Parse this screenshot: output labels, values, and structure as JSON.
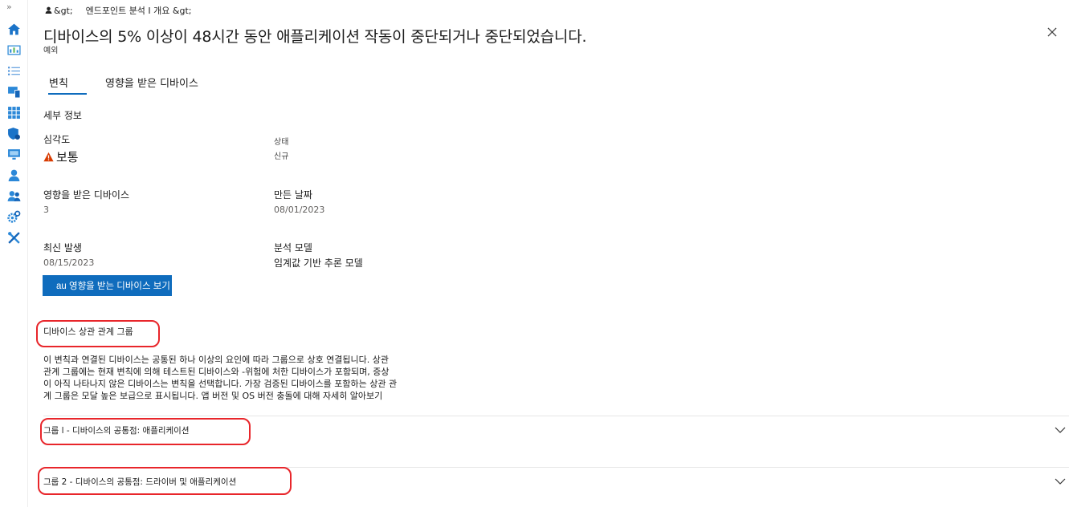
{
  "nav": {
    "expand_label": "»",
    "items": [
      {
        "icon": "home-icon"
      },
      {
        "icon": "dashboard-icon"
      },
      {
        "icon": "list-icon"
      },
      {
        "icon": "devices-icon"
      },
      {
        "icon": "apps-grid-icon"
      },
      {
        "icon": "security-icon"
      },
      {
        "icon": "monitor-icon"
      },
      {
        "icon": "user-icon"
      },
      {
        "icon": "users-icon"
      },
      {
        "icon": "settings-icon"
      },
      {
        "icon": "tools-icon"
      }
    ]
  },
  "breadcrumb": {
    "part1": "&gt;",
    "part2": "엔드포인트 분석 I 개요 &gt;"
  },
  "header": {
    "title": "디바이스의 5% 이상이 48시간 동안 애플리케이션 작동이 중단되거나 중단되었습니다.",
    "subtitle": "예외"
  },
  "tabs": [
    {
      "label": "변칙",
      "active": true
    },
    {
      "label": "영향을 받은 디바이스",
      "active": false
    }
  ],
  "details": {
    "section_title": "세부 정보",
    "severity_label": "심각도",
    "severity_value": "보통",
    "status_label": "상태",
    "status_value": "신규",
    "affected_label": "영향을 받은 디바이스",
    "affected_value": "3",
    "created_label": "만든 날짜",
    "created_value": "08/01/2023",
    "latest_label": "최신 발생",
    "latest_value": "08/15/2023",
    "model_label": "분석 모델",
    "model_value": "임계값 기반 추론 모델"
  },
  "view_button": "au 영향을 받는 디바이스 보기",
  "correlation": {
    "title": "디바이스 상관 관계 그룹",
    "lines": [
      "이 변칙과 연결된 디바이스는 공통된 하나 이상의 요인에 따라 그룹으로 상호 연결됩니다. 상관",
      "관계 그룹에는 현재 변칙에 의해 테스트된 디바이스와 -위험에 처한 디바이스가 포함되며, 증상",
      "이 아직 나타나지 않은 디바이스는 변칙을 선택합니다. 가장 검증된 디바이스를 포함하는 상관 관",
      "계 그룹은 모달 높은 보급으로 표시됩니다. 앱 버전 및 OS 버전 충돌에 대해 자세히 알아보기"
    ]
  },
  "groups": [
    {
      "label": "그룹 l - 디바이스의 공통점: 애플리케이션"
    },
    {
      "label": "그룹 2 - 디바이스의 공통점: 드라이버 및 애플리케이션"
    }
  ],
  "colors": {
    "accent": "#0f6cbd",
    "warning": "#d83b01",
    "highlight": "#e8262b"
  }
}
